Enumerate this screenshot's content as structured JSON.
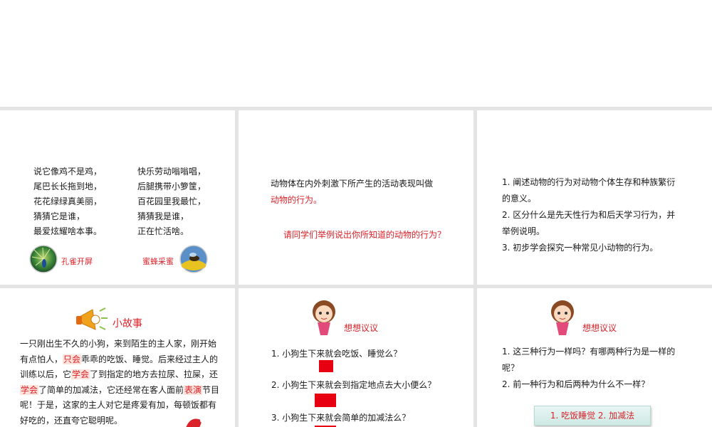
{
  "slide1": {
    "poem_left": [
      "说它像鸡不是鸡，",
      "尾巴长长拖到地，",
      "花花绿绿真美丽，",
      "猜猜它是谁，",
      "最爱炫耀啥本事。"
    ],
    "poem_right": [
      "快乐劳动嗡嗡唱，",
      "后腿携带小箩筐，",
      "百花园里我最忙，",
      "猜猜我是谁，",
      "正在忙活啥。"
    ],
    "caption_left": "孔雀开屏",
    "caption_right": "蜜蜂采蜜"
  },
  "slide2": {
    "line1": "动物体在内外刺激下所产生的活动表现叫做",
    "line2": "动物的行为。",
    "question": "请同学们举例说出你所知道的动物的行为？"
  },
  "slide3": {
    "lines": [
      "1. 阐述动物的行为对动物个体生存和种族繁衍",
      "的意义。",
      "2. 区分什么是先天性行为和后天学习行为，并",
      "举例说明。",
      "3. 初步学会探究一种常见小动物的行为。"
    ]
  },
  "slide4": {
    "title": "小故事",
    "l1": "一只刚出生不久的小狗，来到陌生的主人家，刚开始",
    "l2a": "有点怕人，",
    "l2hl": "只会",
    "l2b": "乖乖的吃饭、睡觉。后来经过主人的",
    "l3a": "训练以后，它",
    "l3hl": "学会",
    "l3b": "了到指定的地方去拉尿、拉屎，还",
    "l4hl1": "学会",
    "l4a": "了简单的加减法，它还经常在客人面前",
    "l4hl2": "表演",
    "l4b": "节目",
    "l5": "呢！于是，这家的主人对它是疼爱有加，每顿饭都有",
    "l6": "好吃的，还直夸它聪明呢。"
  },
  "slide5": {
    "title": "想想议议",
    "q1": "1.  小狗生下来就会吃饭、睡觉么？",
    "q2": "2.  小狗生下来就会到指定地点去大小便么？",
    "q3": "3.  小狗生下来就会简单的加减法么？"
  },
  "slide6": {
    "title": "想想议议",
    "l1": "1. 这三种行为一样吗？有哪两种行为是一样的",
    "l2": "呢？",
    "l3": "2. 前一种行为和后两种为什么不一样？",
    "answer": "1.  吃饭睡觉    2.  加减法"
  }
}
